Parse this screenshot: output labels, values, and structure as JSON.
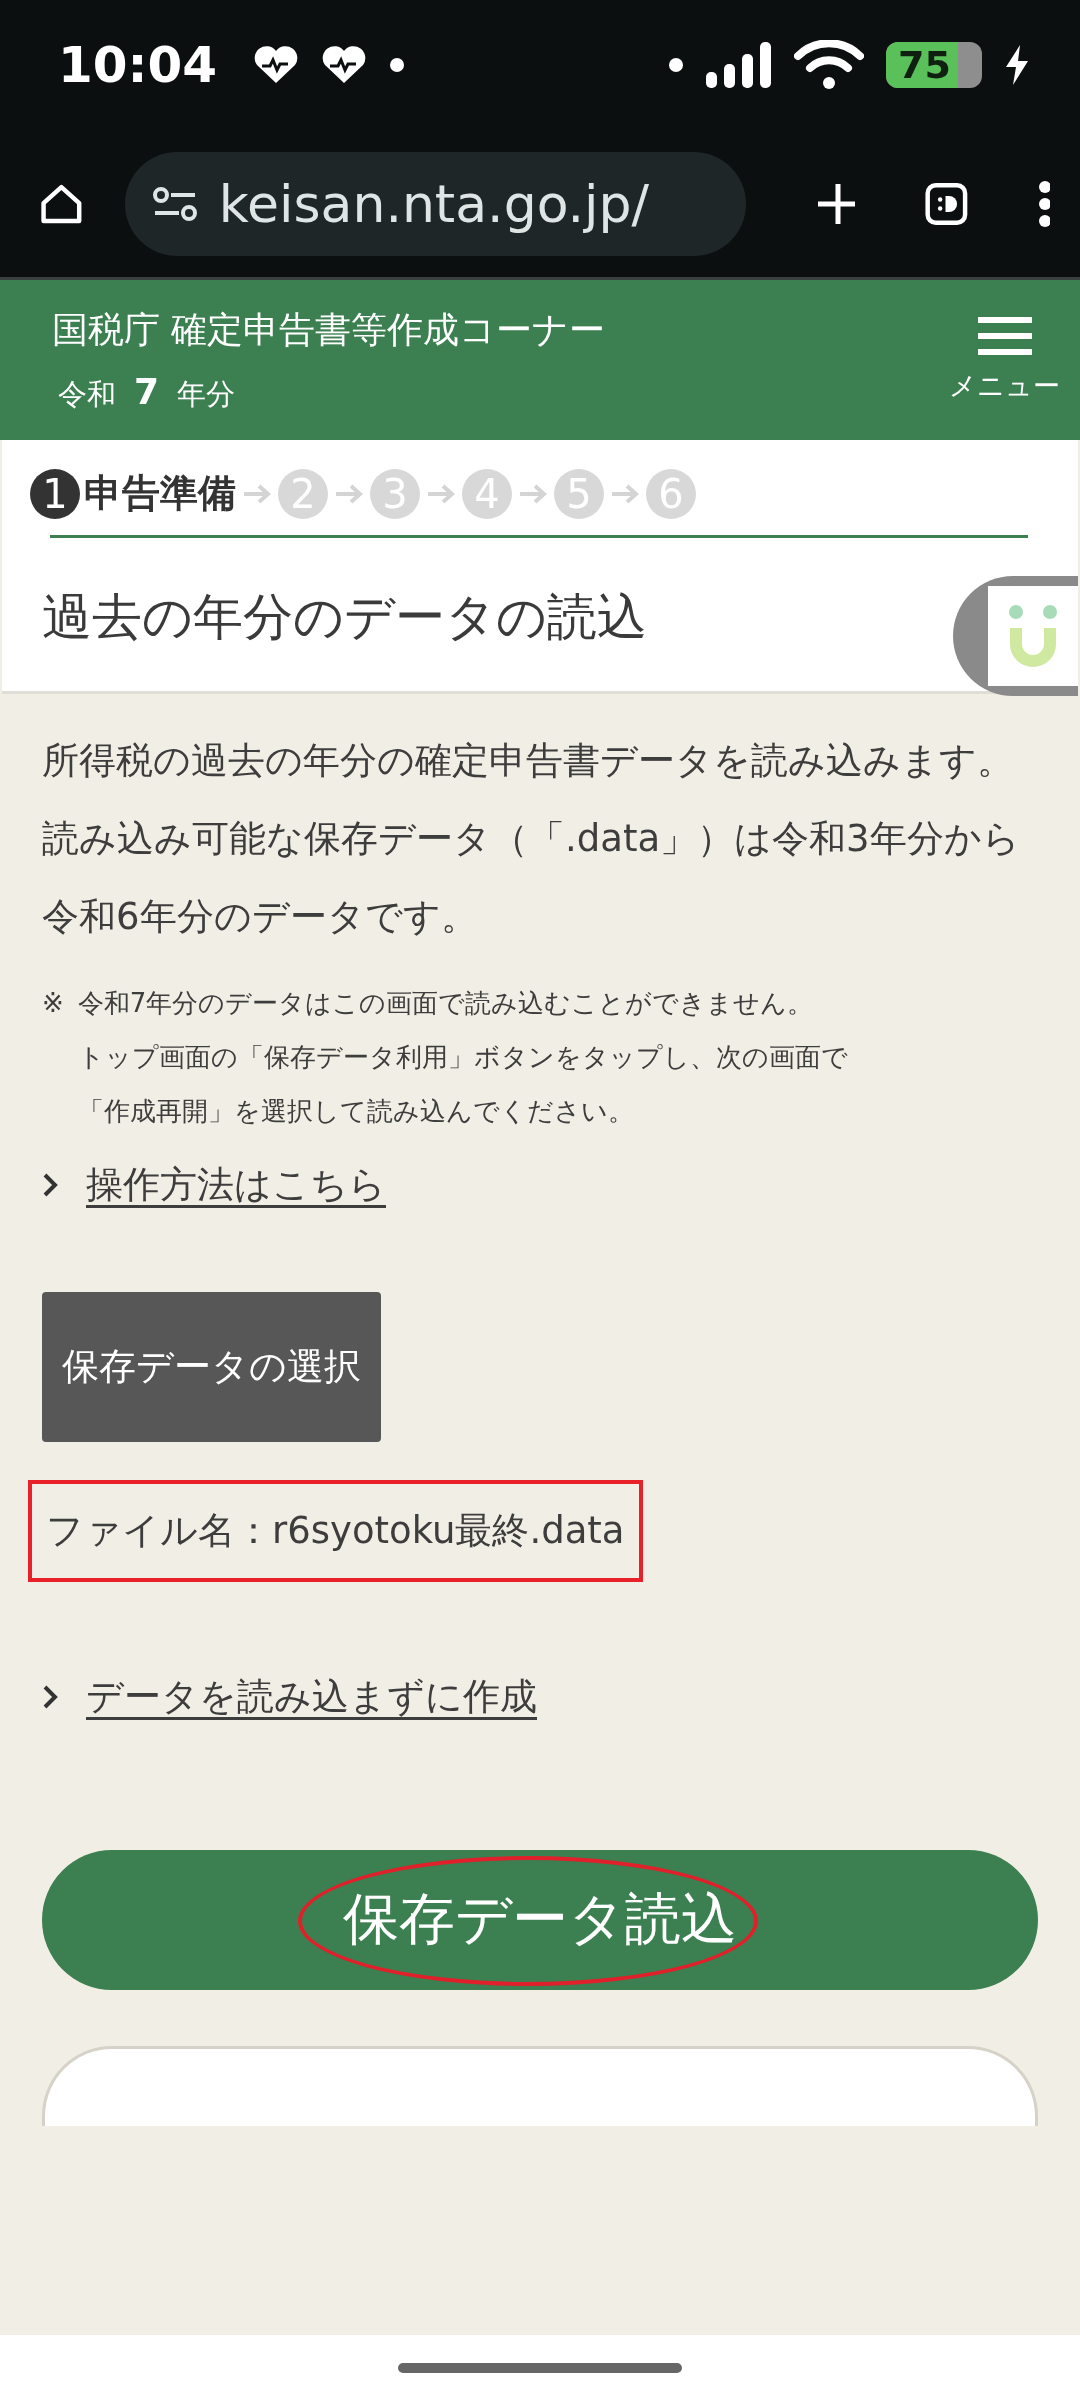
{
  "status_bar": {
    "time": "10:04",
    "battery": "75"
  },
  "browser": {
    "url": "keisan.nta.go.jp/"
  },
  "header": {
    "title": "国税庁 確定申告書等作成コーナー",
    "year_prefix": "令和",
    "year": "7",
    "year_suffix": "年分",
    "menu_label": "メニュー"
  },
  "steps": [
    {
      "number": "1",
      "label": "申告準備",
      "selected": true
    },
    {
      "number": "2",
      "selected": false
    },
    {
      "number": "3",
      "selected": false
    },
    {
      "number": "4",
      "selected": false
    },
    {
      "number": "5",
      "selected": false
    },
    {
      "number": "6",
      "selected": false
    }
  ],
  "page_title": "過去の年分のデータの読込",
  "paragraphs": [
    "所得税の過去の年分の確定申告書データを読み込みます。",
    "読み込み可能な保存データ（「.data」）は令和3年分から令和6年分のデータです。"
  ],
  "note": {
    "mark": "※",
    "lines": [
      "令和7年分のデータはこの画面で読み込むことができません。",
      "トップ画面の「保存データ利用」ボタンをタップし、次の画面で",
      "「作成再開」を選択して読み込んでください。"
    ]
  },
  "help_link": "操作方法はこちら",
  "select_button": "保存データの選択",
  "file_name": {
    "text": "ファイル名：r6syotoku最終.data",
    "highlighted": true
  },
  "skip_link": "データを読み込まずに作成",
  "load_button": {
    "label": "保存データ読込",
    "circled": true
  }
}
